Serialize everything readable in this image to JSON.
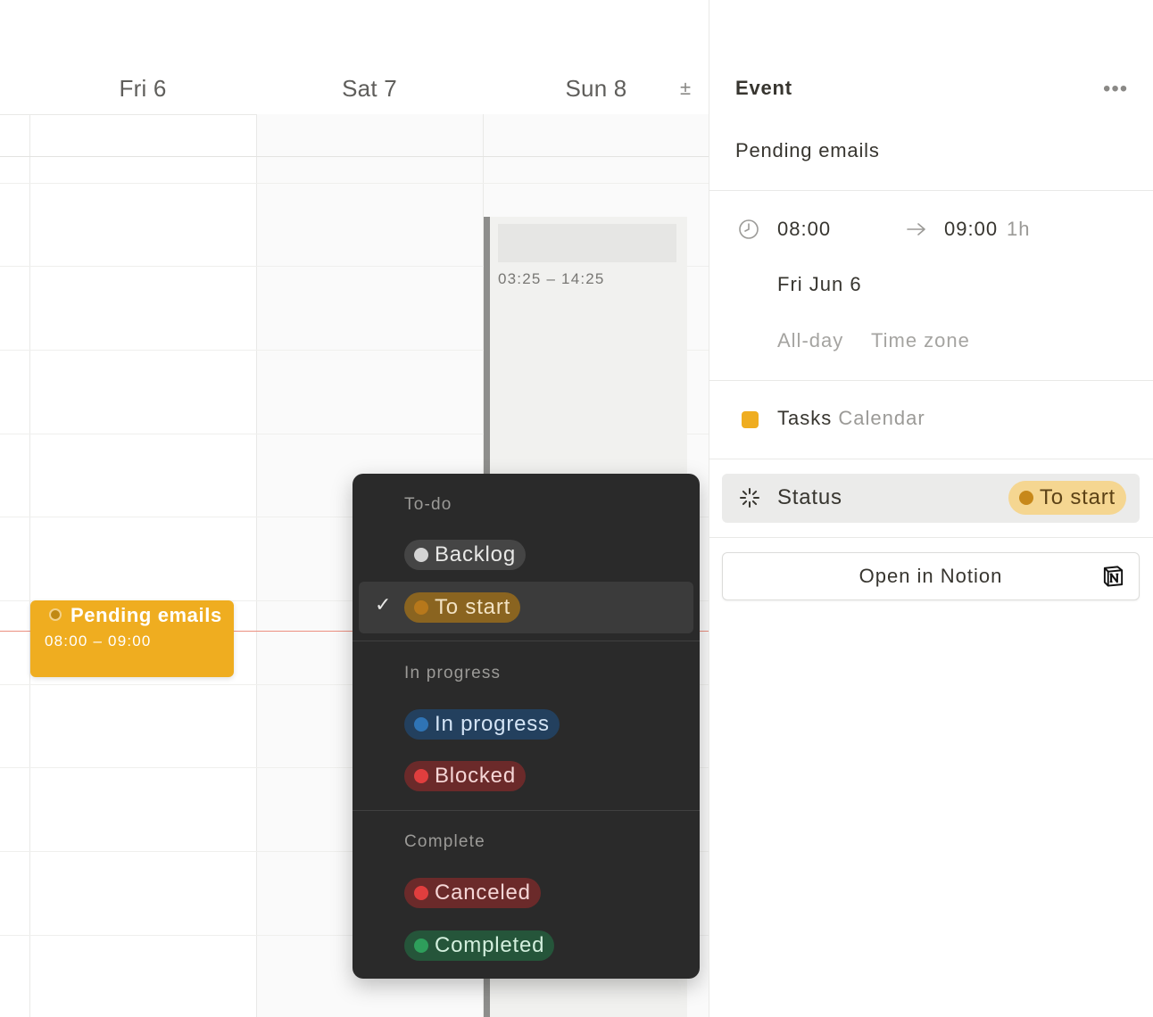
{
  "calendar": {
    "days": [
      "Fri 6",
      "Sat 7",
      "Sun 8"
    ],
    "zoom_control": "±",
    "events": {
      "fri": {
        "title": "Pending emails",
        "time": "08:00 – 09:00"
      },
      "sun": {
        "time": "03:25 – 14:25"
      }
    }
  },
  "status_menu": {
    "groups": [
      {
        "label": "To-do",
        "options": [
          {
            "label": "Backlog",
            "selected": false,
            "dot_color": "#d3d3d3",
            "pill_bg": "#454545",
            "text_color": "#e8e8e6"
          },
          {
            "label": "To start",
            "selected": true,
            "dot_color": "#b7781b",
            "pill_bg": "#8a6420",
            "text_color": "#f3e3c4"
          }
        ]
      },
      {
        "label": "In progress",
        "options": [
          {
            "label": "In progress",
            "selected": false,
            "dot_color": "#2f74b5",
            "pill_bg": "#23405e",
            "text_color": "#d4e4f5"
          },
          {
            "label": "Blocked",
            "selected": false,
            "dot_color": "#e03e3e",
            "pill_bg": "#6b2a2a",
            "text_color": "#f5d6d6"
          }
        ]
      },
      {
        "label": "Complete",
        "options": [
          {
            "label": "Canceled",
            "selected": false,
            "dot_color": "#e03e3e",
            "pill_bg": "#6b2a2a",
            "text_color": "#f5d6d6"
          },
          {
            "label": "Completed",
            "selected": false,
            "dot_color": "#2e9e5b",
            "pill_bg": "#25553a",
            "text_color": "#d3efdd"
          }
        ]
      }
    ],
    "check_glyph": "✓"
  },
  "panel": {
    "header_title": "Event",
    "more_icon": "•••",
    "event_name": "Pending emails",
    "start_time": "08:00",
    "end_time": "09:00",
    "duration": "1h",
    "date": "Fri Jun 6",
    "all_day_label": "All-day",
    "time_zone_label": "Time zone",
    "calendar_name": "Tasks",
    "calendar_suffix": "Calendar",
    "status_label": "Status",
    "status_value": "To start",
    "open_button": "Open in Notion"
  },
  "colors": {
    "accent_yellow": "#efad20",
    "now_line": "#eb8f80",
    "menu_bg": "#2a2a2a"
  }
}
